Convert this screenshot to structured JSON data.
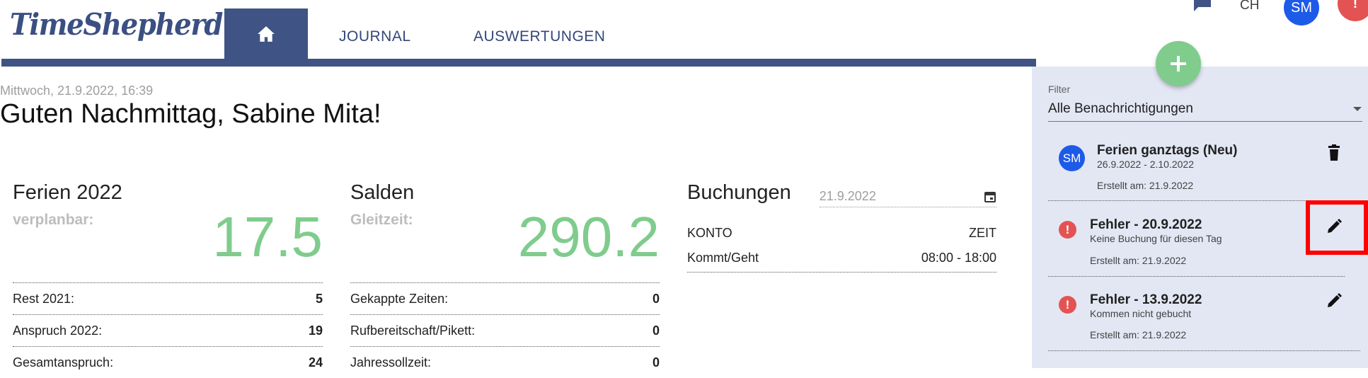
{
  "app": {
    "logo": "TimeShepherd"
  },
  "nav": {
    "tabs": [
      {
        "label": "JOURNAL"
      },
      {
        "label": "AUSWERTUNGEN"
      }
    ]
  },
  "topbar": {
    "lang": "CH",
    "avatar": "SM"
  },
  "header": {
    "date": "Mittwoch, 21.9.2022, 16:39",
    "greeting": "Guten Nachmittag, Sabine Mita!"
  },
  "ferien": {
    "title": "Ferien 2022",
    "label": "verplanbar:",
    "value": "17.5",
    "rows": [
      {
        "label": "Rest 2021:",
        "value": "5"
      },
      {
        "label": "Anspruch 2022:",
        "value": "19"
      },
      {
        "label": "Gesamtanspruch:",
        "value": "24"
      }
    ]
  },
  "salden": {
    "title": "Salden",
    "label": "Gleitzeit:",
    "value": "290.2",
    "rows": [
      {
        "label": "Gekappte Zeiten:",
        "value": "0"
      },
      {
        "label": "Rufbereitschaft/Pikett:",
        "value": "0"
      },
      {
        "label": "Jahressollzeit:",
        "value": "0"
      }
    ]
  },
  "buchungen": {
    "title": "Buchungen",
    "date": "21.9.2022",
    "col_konto": "KONTO",
    "col_zeit": "ZEIT",
    "rows": [
      {
        "konto": "Kommt/Geht",
        "zeit": "08:00 - 18:00"
      }
    ]
  },
  "notifications": {
    "filter_label": "Filter",
    "filter_value": "Alle Benachrichtigungen",
    "items": [
      {
        "title": "Ferien ganztags (Neu)",
        "sub": "26.9.2022 - 2.10.2022",
        "created": "Erstellt am: 21.9.2022",
        "avatar": "SM"
      },
      {
        "title": "Fehler - 20.9.2022",
        "sub": "Keine Buchung für diesen Tag",
        "created": "Erstellt am: 21.9.2022",
        "icon": "!"
      },
      {
        "title": "Fehler - 13.9.2022",
        "sub": "Kommen nicht gebucht",
        "created": "Erstellt am: 21.9.2022",
        "icon": "!"
      }
    ]
  },
  "colors": {
    "primary": "#3f5484",
    "accent_green": "#7fcc8d",
    "panel": "#e3e7f4",
    "error": "#e35353",
    "avatar": "#1e5ae8",
    "highlight": "#ff0000"
  }
}
